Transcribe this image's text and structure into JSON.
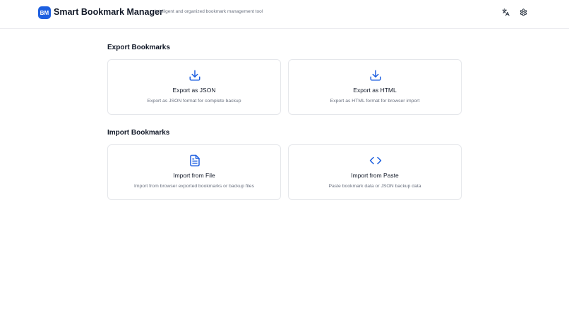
{
  "header": {
    "logo_text": "BM",
    "title": "Smart Bookmark Manager",
    "subtitle": "Intelligent and organized bookmark management tool",
    "language_icon": "translate-icon",
    "settings_icon": "gear-icon"
  },
  "export_section": {
    "title": "Export Bookmarks",
    "cards": [
      {
        "title": "Export as JSON",
        "description": "Export as JSON format for complete backup",
        "icon": "download-icon"
      },
      {
        "title": "Export as HTML",
        "description": "Export as HTML format for browser import",
        "icon": "download-icon"
      }
    ]
  },
  "import_section": {
    "title": "Import Bookmarks",
    "cards": [
      {
        "title": "Import from File",
        "description": "Import from browser exported bookmarks or backup files",
        "icon": "file-text-icon"
      },
      {
        "title": "Import from Paste",
        "description": "Paste bookmark data or JSON backup data",
        "icon": "code-icon"
      }
    ]
  },
  "colors": {
    "accent": "#1d5fe0",
    "border": "#e5e7eb",
    "muted_text": "#6b7280"
  }
}
